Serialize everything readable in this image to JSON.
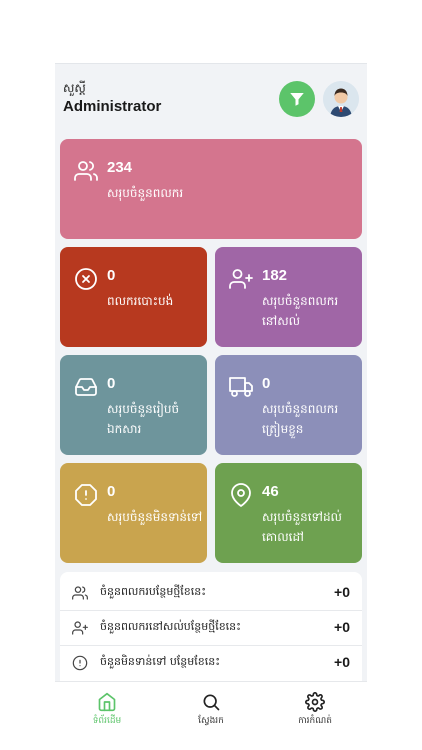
{
  "header": {
    "greeting": "សួស្តី",
    "username": "Administrator"
  },
  "cards": {
    "total_workers": {
      "value": "234",
      "label": "សរុបចំនួនពលករ",
      "icon": "users-icon",
      "color": "#d4758e"
    },
    "abandoned_workers": {
      "value": "0",
      "label": "ពលករបោះបង់",
      "icon": "x-circle-icon",
      "color": "#b7391f"
    },
    "remaining_workers": {
      "value": "182",
      "label": "សរុបចំនួនពលករនៅសល់",
      "icon": "user-plus-icon",
      "color": "#a066a6"
    },
    "documents_prepared": {
      "value": "0",
      "label": "សរុបចំនួនរៀបចំឯកសារ",
      "icon": "inbox-icon",
      "color": "#6e959c"
    },
    "workers_ready": {
      "value": "0",
      "label": "សរុបចំនួនពលករត្រៀមខ្លួន",
      "icon": "truck-icon",
      "color": "#8c8fb9"
    },
    "not_departed": {
      "value": "0",
      "label": "សរុបចំនួនមិនទាន់ទៅ",
      "icon": "alert-octagon-icon",
      "color": "#c9a44e"
    },
    "arrived_destination": {
      "value": "46",
      "label": "សរុបចំនួនទៅដល់គោលដៅ",
      "icon": "map-pin-icon",
      "color": "#6ea150"
    }
  },
  "stats": [
    {
      "label": "ចំនួនពលករបន្ថែមថ្មីខែនេះ",
      "value": "+0",
      "icon": "users-icon"
    },
    {
      "label": "ចំនួនពលករនៅសល់បន្ថែមថ្មីខែនេះ",
      "value": "+0",
      "icon": "user-plus-icon"
    },
    {
      "label": "ចំនួនមិនទាន់ទៅ បន្ថែមខែនេះ",
      "value": "+0",
      "icon": "alert-circle-icon"
    }
  ],
  "nav": [
    {
      "label": "ទំព័រដើម",
      "icon": "home-icon",
      "active": true
    },
    {
      "label": "ស្វែងរក",
      "icon": "search-icon",
      "active": false
    },
    {
      "label": "ការកំណត់",
      "icon": "settings-icon",
      "active": false
    }
  ],
  "colors": {
    "accent": "#5cc46a",
    "background": "#f1f3f6"
  }
}
